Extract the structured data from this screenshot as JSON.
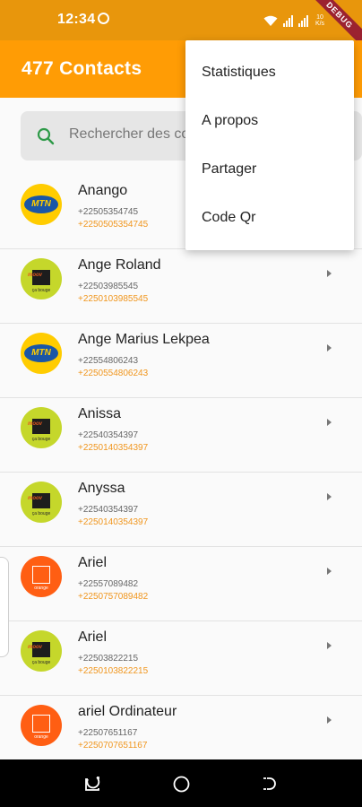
{
  "status_bar": {
    "time": "12:34",
    "network_speed": "10 K/s",
    "debug_banner": "DEBUG"
  },
  "app_bar": {
    "title": "477  Contacts"
  },
  "search": {
    "placeholder": "Rechercher des contacts"
  },
  "menu": {
    "items": [
      "Statistiques",
      "A propos",
      "Partager",
      "Code Qr"
    ]
  },
  "contacts": [
    {
      "name": "Anango",
      "old_number": "+22505354745",
      "new_number": "+2250505354745",
      "operator": "mtn",
      "operator_icon": "mtn-logo-icon"
    },
    {
      "name": "Ange Roland",
      "old_number": "+22503985545",
      "new_number": "+2250103985545",
      "operator": "moov",
      "operator_icon": "moov-logo-icon"
    },
    {
      "name": "Ange Marius Lekpea",
      "old_number": "+22554806243",
      "new_number": "+2250554806243",
      "operator": "mtn",
      "operator_icon": "mtn-logo-icon"
    },
    {
      "name": "Anissa",
      "old_number": "+22540354397",
      "new_number": "+2250140354397",
      "operator": "moov",
      "operator_icon": "moov-logo-icon"
    },
    {
      "name": "Anyssa",
      "old_number": "+22540354397",
      "new_number": "+2250140354397",
      "operator": "moov",
      "operator_icon": "moov-logo-icon"
    },
    {
      "name": "Ariel",
      "old_number": "+22557089482",
      "new_number": "+2250757089482",
      "operator": "orange",
      "operator_icon": "orange-logo-icon"
    },
    {
      "name": "Ariel",
      "old_number": "+22503822215",
      "new_number": "+2250103822215",
      "operator": "moov",
      "operator_icon": "moov-logo-icon"
    },
    {
      "name": "ariel Ordinateur",
      "old_number": "+22507651167",
      "new_number": "+2250707651167",
      "operator": "orange",
      "operator_icon": "orange-logo-icon"
    }
  ],
  "logo_text": {
    "mtn": "MTN",
    "moov": "moov",
    "moov_sub": "ça bouge",
    "orange_sub": "orange"
  },
  "colors": {
    "status_bar": "#e8960c",
    "app_bar": "#ff9c05",
    "new_number": "#f0961e",
    "mtn": "#ffcc00",
    "moov": "#c5d72b",
    "orange": "#ff5e13"
  }
}
